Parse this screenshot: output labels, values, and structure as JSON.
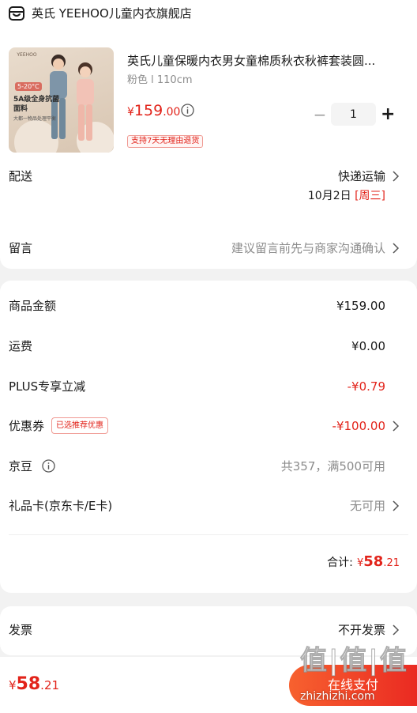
{
  "colors": {
    "accent": "#e2231a",
    "pay_gradient_start": "#f7612f",
    "pay_gradient_end": "#ea2a22",
    "muted": "#8c8c8c",
    "background": "#f2f2f2"
  },
  "shop": {
    "icon": "store-icon",
    "name": "英氏 YEEHOO儿童内衣旗舰店"
  },
  "product": {
    "image": {
      "logo": "YEEHOO",
      "badge": "5-20°C",
      "headline": "5A级全身抗菌面料",
      "subline": "大都一物品处理平衡"
    },
    "title": "英氏儿童保暖内衣男女童棉质秋衣秋裤套装圆...",
    "spec": "粉色 l 110cm",
    "price": {
      "currency": "¥",
      "integer": "159",
      "decimal": ".00"
    },
    "returns_badge": "支持7天无理由退货",
    "quantity": {
      "minus": "−",
      "value": "1",
      "plus": "+"
    }
  },
  "delivery": {
    "label": "配送",
    "method": "快递运输",
    "date": "10月2日",
    "weekday": "[周三]"
  },
  "message": {
    "label": "留言",
    "placeholder": "建议留言前先与商家沟通确认"
  },
  "summary": {
    "goods_amount": {
      "label": "商品金额",
      "value": "¥159.00"
    },
    "shipping": {
      "label": "运费",
      "value": "¥0.00"
    },
    "plus_discount": {
      "label": "PLUS专享立减",
      "value": "-¥0.79"
    },
    "coupon": {
      "label": "优惠券",
      "badge": "已选推荐优惠",
      "value": "-¥100.00"
    },
    "jd_beans": {
      "label": "京豆",
      "value": "共357，满500可用"
    },
    "gift_card": {
      "label": "礼品卡(京东卡/E卡)",
      "value": "无可用"
    },
    "total": {
      "label": "合计:",
      "currency": "¥",
      "integer": "58",
      "decimal": ".21"
    }
  },
  "invoice": {
    "label": "发票",
    "value": "不开发票"
  },
  "bottom": {
    "currency": "¥",
    "integer": "58",
    "decimal": ".21",
    "pay_label": "在线支付"
  },
  "watermark": {
    "logo": "值|值|值",
    "url": "zhizhizhi.com"
  }
}
